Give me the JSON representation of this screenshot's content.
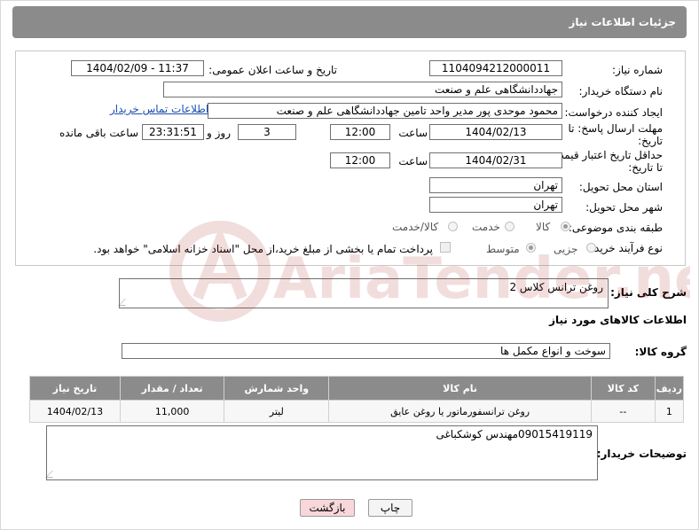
{
  "header": {
    "title": "جزئیات اطلاعات نیاز"
  },
  "form": {
    "need_number": {
      "label": "شماره نیاز:",
      "value": "1104094212000011"
    },
    "announce_datetime": {
      "label": "تاریخ و ساعت اعلان عمومی:",
      "value": "1404/02/09 - 11:37"
    },
    "buyer_org": {
      "label": "نام دستگاه خریدار:",
      "value": "جهاددانشگاهی علم و صنعت"
    },
    "requester": {
      "label": "ایجاد کننده درخواست:",
      "value": "محمود موحدی پور مدیر واحد تامین جهاددانشگاهی علم و صنعت",
      "contact_link": "اطلاعات تماس خریدار"
    },
    "response_deadline": {
      "label_line1": "مهلت ارسال پاسخ: تا",
      "label_line2": "تاریخ:",
      "date": "1404/02/13",
      "time_label": "ساعت",
      "time": "12:00",
      "days": "3",
      "days_label": "روز و",
      "remaining": "23:31:51",
      "remaining_label": "ساعت باقی مانده"
    },
    "price_validity": {
      "label_line1": "حداقل تاریخ اعتبار قیمت:",
      "label_line2": "تا تاریخ:",
      "date": "1404/02/31",
      "time_label": "ساعت",
      "time": "12:00"
    },
    "delivery_province": {
      "label": "استان محل تحویل:",
      "value": "تهران"
    },
    "delivery_city": {
      "label": "شهر محل تحویل:",
      "value": "تهران"
    },
    "category": {
      "label": "طبقه بندی موضوعی:",
      "options": [
        "کالا",
        "خدمت",
        "کالا/خدمت"
      ],
      "selected": "کالا"
    },
    "purchase_process": {
      "label": "نوع فرآیند خرید :",
      "options": [
        "جزیی",
        "متوسط"
      ],
      "selected": "متوسط",
      "treasury_note": "پرداخت تمام یا بخشی از مبلغ خرید،از محل \"اسناد خزانه اسلامی\" خواهد بود."
    }
  },
  "description": {
    "label": "شرح کلی نیاز:",
    "value": "روغن ترانس کلاس 2"
  },
  "goods_section": {
    "title": "اطلاعات کالاهای مورد نیاز",
    "group_label": "گروه کالا:",
    "group_value": "سوخت و انواع مکمل ها",
    "columns": [
      "ردیف",
      "کد کالا",
      "نام کالا",
      "واحد شمارش",
      "تعداد / مقدار",
      "تاریخ نیاز"
    ],
    "rows": [
      {
        "row": "1",
        "code": "--",
        "name": "روغن ترانسفورماتور یا روغن عایق",
        "unit": "لیتر",
        "qty": "11,000",
        "date": "1404/02/13"
      }
    ]
  },
  "buyer_notes": {
    "label": "توضیحات خریدار:",
    "value": "09015419119مهندس کوشکباغی"
  },
  "buttons": {
    "print": "چاپ",
    "back": "بازگشت"
  },
  "watermark": {
    "text": "AriaTender.neT"
  },
  "colors": {
    "header_bg": "#8b8b8b",
    "link": "#1a4fb0",
    "back_button_bg": "#f8d7da",
    "print_button_bg": "#f4f4f4"
  }
}
